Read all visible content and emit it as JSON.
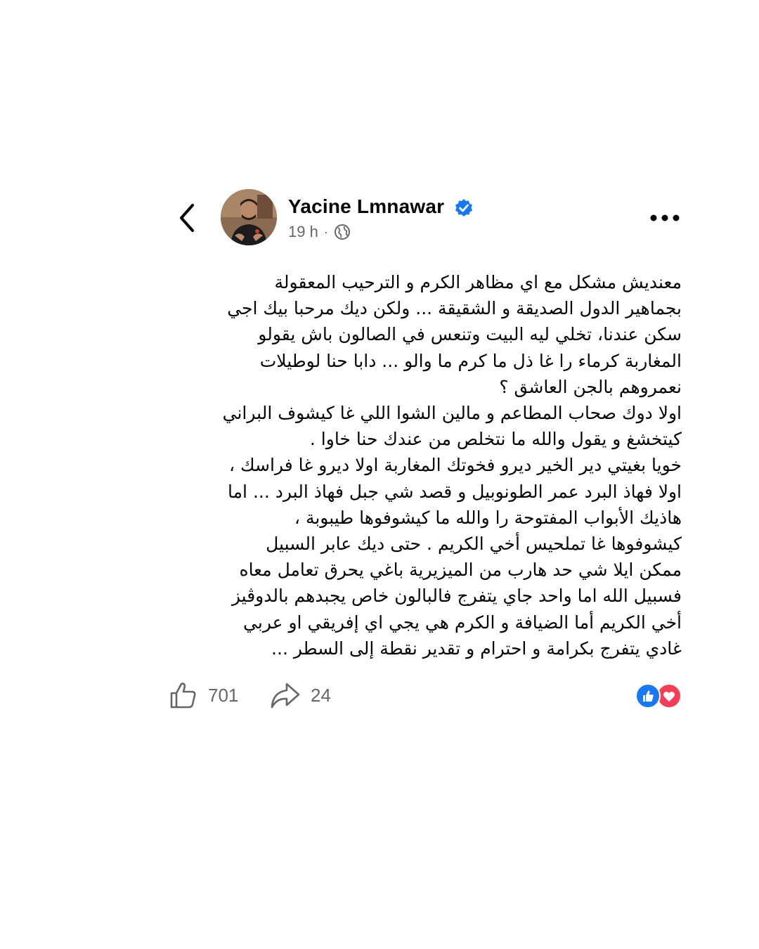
{
  "post": {
    "author": {
      "name": "Yacine Lmnawar",
      "verified": true
    },
    "meta": {
      "time": "19 h",
      "separator": "·",
      "audience_icon": "globe-icon"
    },
    "text_lines": [
      "معنديش مشكل مع اي مظاهر الكرم و الترحيب المعقولة",
      "بجماهير الدول الصديقة و الشقيقة ... ولكن ديك مرحبا بيك اجي",
      "سكن عندنا، تخلي ليه البيت وتنعس في الصالون باش يقولو",
      "المغاربة كرماء را غا ذل ما كرم ما والو ... دابا حنا لوطيلات",
      "نعمروهم بالجن العاشق ؟",
      "اولا دوك صحاب المطاعم و مالين الشوا اللي غا كيشوف البراني",
      "كيتخشغ و يقول والله ما نتخلص من عندك حنا خاوا .",
      "خويا بغيتي دير الخير ديرو فخوتك المغاربة اولا ديرو غا فراسك ،",
      "اولا فهاذ البرد عمر الطونوبيل و قصد شي جبل فهاذ البرد ...  اما",
      "هاذيك الأبواب المفتوحة را والله ما كيشوفوها طيبوبة ،",
      "كيشوفوها غا تملحيس أخي الكريم .  حتى ديك عابر السبيل",
      "ممكن ايلا شي حد هارب من الميزيرية باغي يحرق تعامل معاه",
      "فسبيل الله اما واحد جاي يتفرج فالبالون خاص يجبدهم بالدوڤيز",
      "أخي الكريم أما الضيافة و الكرم هي يجي اي إفريقي او عربي",
      "غادي يتفرج بكرامة و احترام و تقدير نقطة إلى السطر  ..."
    ],
    "stats": {
      "likes": "701",
      "shares": "24"
    },
    "reactions": [
      "like",
      "love"
    ],
    "colors": {
      "accent": "#1877f2",
      "love": "#f33e58",
      "secondary_text": "#65676b"
    }
  }
}
